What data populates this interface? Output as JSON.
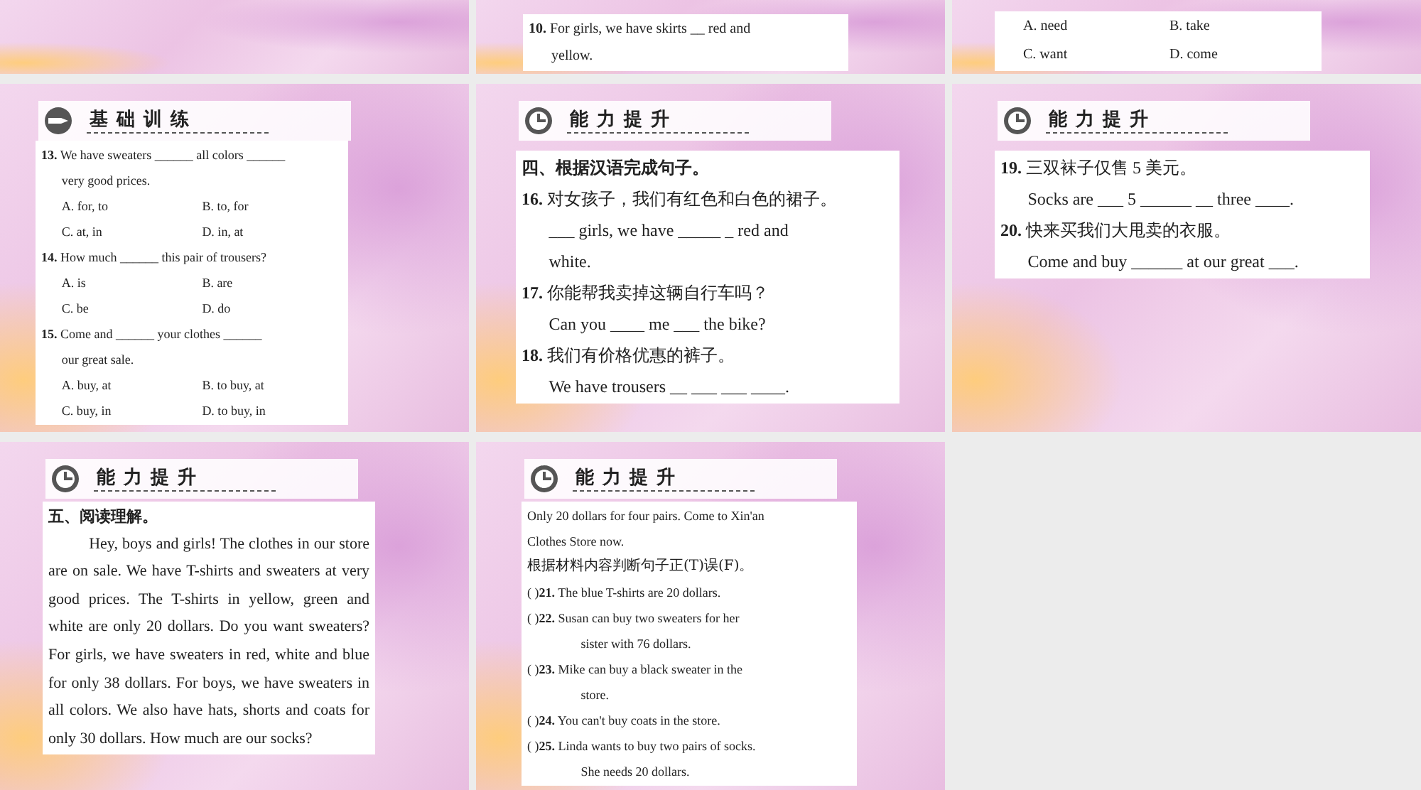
{
  "slides": [
    {
      "kind": "blank"
    },
    {
      "kind": "content",
      "box": {
        "lines": [
          {
            "kind": "question",
            "text": "**10.** For girls, we have skirts __ red and"
          },
          {
            "kind": "cont",
            "text": "yellow."
          }
        ]
      }
    },
    {
      "kind": "content",
      "box": {
        "lines": [
          {
            "kind": "options",
            "items": [
              "A. need",
              "B. take"
            ]
          },
          {
            "kind": "options",
            "items": [
              "C. want",
              "D. come"
            ]
          }
        ]
      }
    },
    {
      "kind": "content",
      "header": {
        "kind": "basic",
        "title": "基础训练"
      },
      "box": {
        "lines": [
          {
            "kind": "question",
            "text": "**13.** We have sweaters ______ all colors ______"
          },
          {
            "kind": "cont",
            "text": "very good prices."
          },
          {
            "kind": "options",
            "items": [
              "A. for, to",
              "B. to, for"
            ]
          },
          {
            "kind": "options",
            "items": [
              "C. at, in",
              "D. in, at"
            ]
          },
          {
            "kind": "question",
            "text": "**14.** How much ______ this pair of trousers?"
          },
          {
            "kind": "options",
            "items": [
              "A. is",
              "B. are"
            ]
          },
          {
            "kind": "options",
            "items": [
              "C. be",
              "D. do"
            ]
          },
          {
            "kind": "question",
            "text": "**15.** Come and ______ your clothes ______"
          },
          {
            "kind": "cont",
            "text": "our great sale."
          },
          {
            "kind": "options",
            "items": [
              "A. buy, at",
              "B. to buy, at"
            ]
          },
          {
            "kind": "options",
            "items": [
              "C. buy, in",
              "D. to buy, in"
            ]
          }
        ]
      }
    },
    {
      "kind": "content",
      "header": {
        "kind": "advanced",
        "title": "能力提升"
      },
      "box": {
        "lines": [
          {
            "kind": "heading",
            "text": "四、根据汉语完成句子。"
          },
          {
            "kind": "question",
            "text": "**16.** 对女孩子，我们有红色和白色的裙子。"
          },
          {
            "kind": "cont",
            "text": "___ girls, we have _____ _ red and"
          },
          {
            "kind": "cont",
            "text": "white."
          },
          {
            "kind": "question",
            "text": "**17.** 你能帮我卖掉这辆自行车吗？"
          },
          {
            "kind": "cont",
            "text": "Can you ____ me ___ the bike?"
          },
          {
            "kind": "question",
            "text": "**18.** 我们有价格优惠的裤子。"
          },
          {
            "kind": "cont",
            "text": "We have trousers __ ___ ___ ____."
          }
        ]
      }
    },
    {
      "kind": "content",
      "header": {
        "kind": "advanced",
        "title": "能力提升"
      },
      "box": {
        "lines": [
          {
            "kind": "question",
            "text": "**19.** 三双袜子仅售 5 美元。"
          },
          {
            "kind": "cont",
            "text": "Socks are ___ 5 ______ __ three ____."
          },
          {
            "kind": "question",
            "text": "**20.** 快来买我们大甩卖的衣服。"
          },
          {
            "kind": "cont",
            "text": "Come and buy ______ at our great ___."
          }
        ]
      }
    },
    {
      "kind": "content",
      "header": {
        "kind": "advanced",
        "title": "能力提升"
      },
      "box": {
        "lines": [
          {
            "kind": "heading",
            "text": "五、阅读理解。"
          },
          {
            "kind": "para",
            "text": "Hey, boys and girls! The clothes in our store are on sale. We have T-shirts and sweaters at very good prices. The T-shirts in yellow, green and white are only 20 dollars. Do you want sweaters? For girls, we have sweaters in red, white and blue for only 38 dollars. For boys, we have sweaters in all colors. We also have hats, shorts and coats for only 30 dollars. How much are our socks?"
          }
        ]
      }
    },
    {
      "kind": "content",
      "header": {
        "kind": "advanced",
        "title": "能力提升"
      },
      "box": {
        "lines": [
          {
            "kind": "plain",
            "text": "Only 20 dollars for four pairs. Come to Xin'an"
          },
          {
            "kind": "plain",
            "text": "Clothes Store now."
          },
          {
            "kind": "instruction",
            "text": "根据材料内容判断句子正(T)误(F)。"
          },
          {
            "kind": "judge",
            "text": "(   )**21.** The blue T-shirts are 20 dollars."
          },
          {
            "kind": "judge",
            "text": "(   )**22.** Susan can buy two sweaters for her"
          },
          {
            "kind": "hang",
            "text": "sister with 76 dollars."
          },
          {
            "kind": "judge",
            "text": "(   )**23.** Mike can buy a black sweater in the"
          },
          {
            "kind": "hang",
            "text": "store."
          },
          {
            "kind": "judge",
            "text": "(   )**24.** You can't buy coats in the store."
          },
          {
            "kind": "judge",
            "text": "(   )**25.** Linda wants to buy two pairs of socks."
          },
          {
            "kind": "hang",
            "text": "She needs 20 dollars."
          }
        ]
      }
    },
    {
      "kind": "empty"
    }
  ]
}
